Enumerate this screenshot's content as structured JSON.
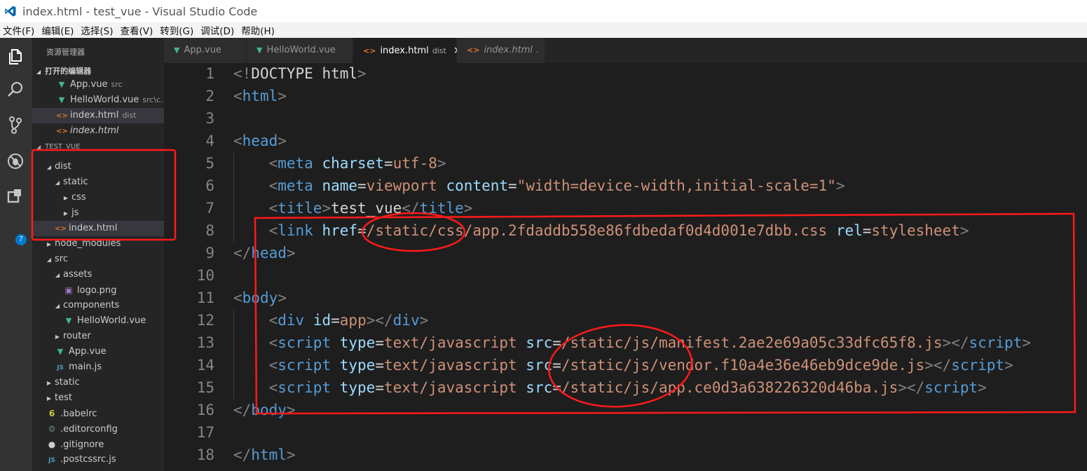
{
  "window": {
    "title": "index.html - test_vue - Visual Studio Code"
  },
  "menu": [
    "文件(F)",
    "编辑(E)",
    "选择(S)",
    "查看(V)",
    "转到(G)",
    "调试(D)",
    "帮助(H)"
  ],
  "activity_bar": {
    "icons": [
      "explorer-icon",
      "search-icon",
      "source-control-icon",
      "debug-icon",
      "extensions-icon"
    ],
    "extensions_badge": "7"
  },
  "sidebar": {
    "title": "资源管理器",
    "open_editors": {
      "header": "打开的编辑器",
      "items": [
        {
          "name": "App.vue",
          "desc": "src",
          "icon": "vue"
        },
        {
          "name": "HelloWorld.vue",
          "desc": "src\\c...",
          "icon": "vue"
        },
        {
          "name": "index.html",
          "desc": "dist",
          "icon": "html",
          "selected": true
        },
        {
          "name": "index.html",
          "desc": "",
          "icon": "html",
          "italic": true
        }
      ]
    },
    "project": {
      "header": "TEST_VUE",
      "items": [
        {
          "name": "dist",
          "indent": 1,
          "twisty": "open"
        },
        {
          "name": "static",
          "indent": 2,
          "twisty": "open"
        },
        {
          "name": "css",
          "indent": 3,
          "twisty": "closed"
        },
        {
          "name": "js",
          "indent": 3,
          "twisty": "closed"
        },
        {
          "name": "index.html",
          "indent": 2,
          "icon": "html",
          "selected": true
        },
        {
          "name": "node_modules",
          "indent": 1,
          "twisty": "closed"
        },
        {
          "name": "src",
          "indent": 1,
          "twisty": "open"
        },
        {
          "name": "assets",
          "indent": 2,
          "twisty": "open"
        },
        {
          "name": "logo.png",
          "indent": 3,
          "icon": "image"
        },
        {
          "name": "components",
          "indent": 2,
          "twisty": "open"
        },
        {
          "name": "HelloWorld.vue",
          "indent": 3,
          "icon": "vue"
        },
        {
          "name": "router",
          "indent": 2,
          "twisty": "closed"
        },
        {
          "name": "App.vue",
          "indent": 2,
          "icon": "vue"
        },
        {
          "name": "main.js",
          "indent": 2,
          "icon": "js"
        },
        {
          "name": "static",
          "indent": 1,
          "twisty": "closed"
        },
        {
          "name": "test",
          "indent": 1,
          "twisty": "closed"
        },
        {
          "name": ".babelrc",
          "indent": 1,
          "icon": "babel"
        },
        {
          "name": ".editorconfig",
          "indent": 1,
          "icon": "config"
        },
        {
          "name": ".gitignore",
          "indent": 1,
          "icon": "git"
        },
        {
          "name": ".postcssrc.js",
          "indent": 1,
          "icon": "js"
        }
      ]
    }
  },
  "tabs": [
    {
      "label": "App.vue",
      "icon": "vue",
      "desc": ""
    },
    {
      "label": "HelloWorld.vue",
      "icon": "vue",
      "desc": ""
    },
    {
      "label": "index.html",
      "icon": "html",
      "desc": "dist",
      "active": true,
      "close": "×"
    },
    {
      "label": "index.html",
      "icon": "html",
      "desc": ".",
      "italic": true
    }
  ],
  "editor": {
    "lines": [
      [
        [
          "tg",
          "<!"
        ],
        [
          "tx",
          "DOCTYPE html"
        ],
        [
          "tg",
          ">"
        ]
      ],
      [
        [
          "tg",
          "<"
        ],
        [
          "tn",
          "html"
        ],
        [
          "tg",
          ">"
        ]
      ],
      [],
      [
        [
          "tg",
          "<"
        ],
        [
          "tn",
          "head"
        ],
        [
          "tg",
          ">"
        ]
      ],
      [
        [
          "tx",
          "    "
        ],
        [
          "tg",
          "<"
        ],
        [
          "tn",
          "meta"
        ],
        [
          "tx",
          " "
        ],
        [
          "an",
          "charset"
        ],
        [
          "tx",
          "="
        ],
        [
          "av",
          "utf-8"
        ],
        [
          "tg",
          ">"
        ]
      ],
      [
        [
          "tx",
          "    "
        ],
        [
          "tg",
          "<"
        ],
        [
          "tn",
          "meta"
        ],
        [
          "tx",
          " "
        ],
        [
          "an",
          "name"
        ],
        [
          "tx",
          "="
        ],
        [
          "av",
          "viewport"
        ],
        [
          "tx",
          " "
        ],
        [
          "an",
          "content"
        ],
        [
          "tx",
          "="
        ],
        [
          "av",
          "\"width=device-width,initial-scale=1\""
        ],
        [
          "tg",
          ">"
        ]
      ],
      [
        [
          "tx",
          "    "
        ],
        [
          "tg",
          "<"
        ],
        [
          "tn",
          "title"
        ],
        [
          "tg",
          ">"
        ],
        [
          "tx",
          "test_vue"
        ],
        [
          "tg",
          "</"
        ],
        [
          "tn",
          "title"
        ],
        [
          "tg",
          ">"
        ]
      ],
      [
        [
          "tx",
          "    "
        ],
        [
          "tg",
          "<"
        ],
        [
          "tn",
          "link"
        ],
        [
          "tx",
          " "
        ],
        [
          "an",
          "href"
        ],
        [
          "tx",
          "="
        ],
        [
          "av",
          "/static/css/app.2fdaddb558e86fdbedaf0d4d001e7dbb.css"
        ],
        [
          "tx",
          " "
        ],
        [
          "an",
          "rel"
        ],
        [
          "tx",
          "="
        ],
        [
          "av",
          "stylesheet"
        ],
        [
          "tg",
          ">"
        ]
      ],
      [
        [
          "tg",
          "</"
        ],
        [
          "tn",
          "head"
        ],
        [
          "tg",
          ">"
        ]
      ],
      [],
      [
        [
          "tg",
          "<"
        ],
        [
          "tn",
          "body"
        ],
        [
          "tg",
          ">"
        ]
      ],
      [
        [
          "tx",
          "    "
        ],
        [
          "tg",
          "<"
        ],
        [
          "tn",
          "div"
        ],
        [
          "tx",
          " "
        ],
        [
          "an",
          "id"
        ],
        [
          "tx",
          "="
        ],
        [
          "av",
          "app"
        ],
        [
          "tg",
          "></"
        ],
        [
          "tn",
          "div"
        ],
        [
          "tg",
          ">"
        ]
      ],
      [
        [
          "tx",
          "    "
        ],
        [
          "tg",
          "<"
        ],
        [
          "tn",
          "script"
        ],
        [
          "tx",
          " "
        ],
        [
          "an",
          "type"
        ],
        [
          "tx",
          "="
        ],
        [
          "av",
          "text/javascript"
        ],
        [
          "tx",
          " "
        ],
        [
          "an",
          "src"
        ],
        [
          "tx",
          "="
        ],
        [
          "av",
          "/static/js/manifest.2ae2e69a05c33dfc65f8.js"
        ],
        [
          "tg",
          "></"
        ],
        [
          "tn",
          "script"
        ],
        [
          "tg",
          ">"
        ]
      ],
      [
        [
          "tx",
          "    "
        ],
        [
          "tg",
          "<"
        ],
        [
          "tn",
          "script"
        ],
        [
          "tx",
          " "
        ],
        [
          "an",
          "type"
        ],
        [
          "tx",
          "="
        ],
        [
          "av",
          "text/javascript"
        ],
        [
          "tx",
          " "
        ],
        [
          "an",
          "src"
        ],
        [
          "tx",
          "="
        ],
        [
          "av",
          "/static/js/vendor.f10a4e36e46eb9dce9de.js"
        ],
        [
          "tg",
          "></"
        ],
        [
          "tn",
          "script"
        ],
        [
          "tg",
          ">"
        ]
      ],
      [
        [
          "tx",
          "    "
        ],
        [
          "tg",
          "<"
        ],
        [
          "tn",
          "script"
        ],
        [
          "tx",
          " "
        ],
        [
          "an",
          "type"
        ],
        [
          "tx",
          "="
        ],
        [
          "av",
          "text/javascript"
        ],
        [
          "tx",
          " "
        ],
        [
          "an",
          "src"
        ],
        [
          "tx",
          "="
        ],
        [
          "av",
          "/static/js/app.ce0d3a638226320d46ba.js"
        ],
        [
          "tg",
          "></"
        ],
        [
          "tn",
          "script"
        ],
        [
          "tg",
          ">"
        ]
      ],
      [
        [
          "tg",
          "</"
        ],
        [
          "tn",
          "body"
        ],
        [
          "tg",
          ">"
        ]
      ],
      [],
      [
        [
          "tg",
          "</"
        ],
        [
          "tn",
          "html"
        ],
        [
          "tg",
          ">"
        ]
      ]
    ]
  },
  "colors": {
    "annotation": "#ff1a1a",
    "vue": "#41b883",
    "html": "#e37933",
    "js": "#cbcb41",
    "accent": "#007acc"
  }
}
